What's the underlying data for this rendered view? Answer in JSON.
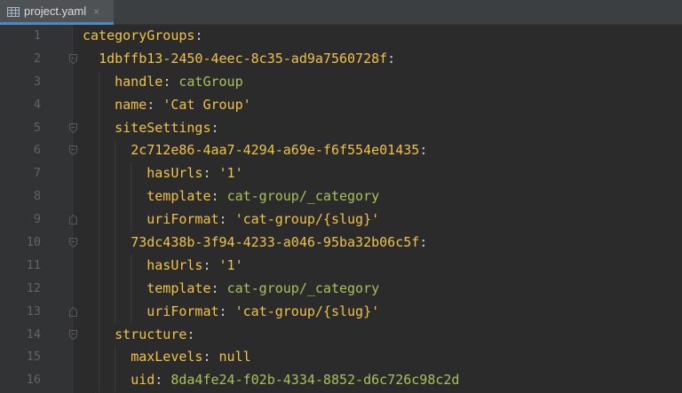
{
  "tab": {
    "icon": "table-icon",
    "label": "project.yaml",
    "close": "×"
  },
  "colors": {
    "key": "#f0c24a",
    "plain_value": "#a5c25c",
    "string_value": "#f0c24a",
    "line_number": "#636363",
    "background": "#2b2b2b",
    "gutter": "#313335"
  },
  "lines": [
    {
      "num": "1",
      "indent": 0,
      "key": "categoryGroups",
      "value": "",
      "vtype": "none"
    },
    {
      "num": "2",
      "indent": 1,
      "key": "1dbffb13-2450-4eec-8c35-ad9a7560728f",
      "value": "",
      "vtype": "none"
    },
    {
      "num": "3",
      "indent": 2,
      "key": "handle",
      "value": "catGroup",
      "vtype": "plain"
    },
    {
      "num": "4",
      "indent": 2,
      "key": "name",
      "value": "'Cat Group'",
      "vtype": "str"
    },
    {
      "num": "5",
      "indent": 2,
      "key": "siteSettings",
      "value": "",
      "vtype": "none"
    },
    {
      "num": "6",
      "indent": 3,
      "key": "2c712e86-4aa7-4294-a69e-f6f554e01435",
      "value": "",
      "vtype": "none"
    },
    {
      "num": "7",
      "indent": 4,
      "key": "hasUrls",
      "value": "'1'",
      "vtype": "str"
    },
    {
      "num": "8",
      "indent": 4,
      "key": "template",
      "value": "cat-group/_category",
      "vtype": "plain"
    },
    {
      "num": "9",
      "indent": 4,
      "key": "uriFormat",
      "value": "'cat-group/{slug}'",
      "vtype": "str"
    },
    {
      "num": "10",
      "indent": 3,
      "key": "73dc438b-3f94-4233-a046-95ba32b06c5f",
      "value": "",
      "vtype": "none"
    },
    {
      "num": "11",
      "indent": 4,
      "key": "hasUrls",
      "value": "'1'",
      "vtype": "str"
    },
    {
      "num": "12",
      "indent": 4,
      "key": "template",
      "value": "cat-group/_category",
      "vtype": "plain"
    },
    {
      "num": "13",
      "indent": 4,
      "key": "uriFormat",
      "value": "'cat-group/{slug}'",
      "vtype": "str"
    },
    {
      "num": "14",
      "indent": 2,
      "key": "structure",
      "value": "",
      "vtype": "none"
    },
    {
      "num": "15",
      "indent": 3,
      "key": "maxLevels",
      "value": "null",
      "vtype": "str"
    },
    {
      "num": "16",
      "indent": 3,
      "key": "uid",
      "value": "8da4fe24-f02b-4334-8852-d6c726c98c2d",
      "vtype": "plain"
    }
  ],
  "folds": [
    "none",
    "open",
    "none",
    "none",
    "open",
    "open",
    "none",
    "none",
    "close",
    "open",
    "none",
    "none",
    "close",
    "open",
    "none",
    "none"
  ]
}
